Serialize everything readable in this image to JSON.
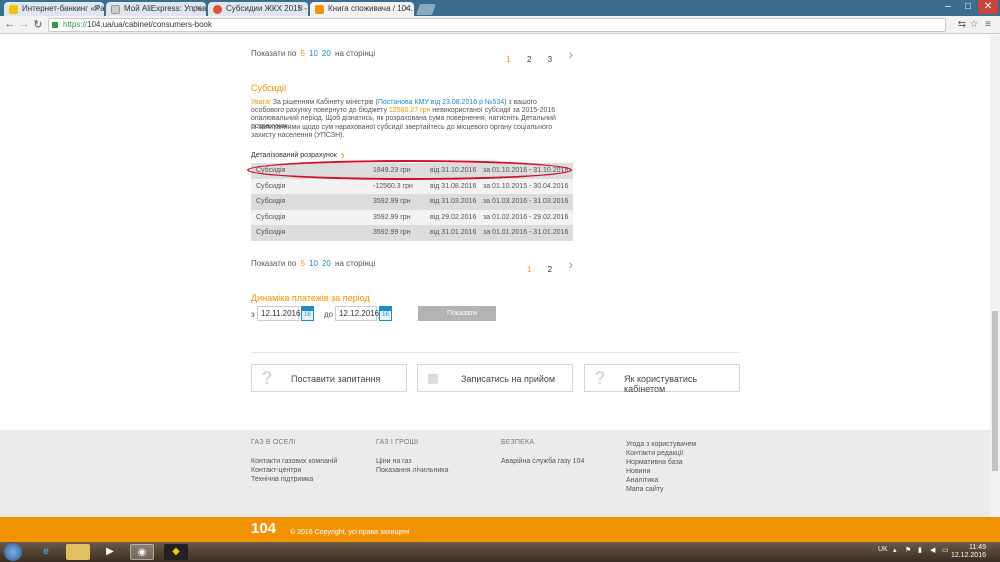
{
  "browser": {
    "tabs": [
      {
        "title": "Интернет-банкинг «Pai",
        "active": false
      },
      {
        "title": "Мой AliExpress: Управл",
        "active": false
      },
      {
        "title": "Субсидии ЖКХ 2015 - С",
        "active": false
      },
      {
        "title": "Книга споживача / 104.",
        "active": true
      }
    ],
    "address": {
      "proto": "https://",
      "rest": "104.ua/ua/cabinet/consumers-book"
    }
  },
  "pager_top": {
    "prefix": "Показати по",
    "n5": "5",
    "n10": "10",
    "n20": "20",
    "suffix": "на сторінці",
    "pages": [
      "1",
      "2",
      "3"
    ],
    "current": "1"
  },
  "subsidy": {
    "title": "Субсидії",
    "notice_warn": "Увага!",
    "notice_a": " За рішенням Кабінету міністрів (",
    "notice_link": "Постанова КМУ від 23.08.2016 р №534",
    "notice_b": ") з вашого особового рахунку повернуто до бюджету ",
    "notice_sum": "12560.27 грн",
    "notice_c": " невикористаної субсидії за 2015-2016 опалювальний період. Щоб дізнатись, як розрахована сума повернення, натисніть Детальний розрахунок.",
    "notice2": "Із запитаннями щодо сум нарахованої субсидії звертайтесь до місцевого органу соціального захисту населення (УПСЗН).",
    "detail_link": "Деталізований розрахунок",
    "rows": [
      {
        "name": "Субсидія",
        "amount": "1849.23 грн",
        "from": "від 31.10.2016",
        "period": "за 01.10.2016 - 31.10.2016"
      },
      {
        "name": "Субсидія",
        "amount": "-12560.3 грн",
        "from": "від 31.08.2016",
        "period": "за 01.10.2015 - 30.04.2016"
      },
      {
        "name": "Субсидія",
        "amount": "3592.99 грн",
        "from": "від 31.03.2016",
        "period": "за 01.03.2016 - 31.03.2016"
      },
      {
        "name": "Субсидія",
        "amount": "3592.99 грн",
        "from": "від 29.02.2016",
        "period": "за 01.02.2016 - 29.02.2016"
      },
      {
        "name": "Субсидія",
        "amount": "3592.99 грн",
        "from": "від 31.01.2016",
        "period": "за 01.01.2016 - 31.01.2016"
      }
    ]
  },
  "pager_bottom": {
    "prefix": "Показати по",
    "n5": "5",
    "n10": "10",
    "n20": "20",
    "suffix": "на сторінці",
    "pages": [
      "1",
      "2"
    ],
    "current": "1"
  },
  "dynamics": {
    "title": "Динаміка платежів за період",
    "from_label": "з",
    "from_value": "12.11.2016",
    "to_label": "до",
    "to_value": "12.12.2016",
    "cal_label": "16",
    "show_button": "Показати"
  },
  "cards": [
    {
      "label": "Поставити запитання",
      "icon": "question-icon"
    },
    {
      "label": "Записатись на прийом",
      "icon": "calendar-icon"
    },
    {
      "label": "Як користуватись кабінетом",
      "icon": "question-icon"
    }
  ],
  "footer": {
    "col1": {
      "title": "ГАЗ В ОСЕЛІ",
      "items": [
        "Контакти газових компаній",
        "Контакт-центри",
        "Технічна підтримка"
      ]
    },
    "col2": {
      "title": "ГАЗ І ГРОШІ",
      "items": [
        "Ціни на газ",
        "Показання лічильника"
      ]
    },
    "col3": {
      "title": "БЕЗПЕКА",
      "items": [
        "Аварійна служба газу 104"
      ]
    },
    "col4": {
      "items": [
        "Угода з користувачем",
        "Контакти редакції",
        "Нормативна база",
        "Новини",
        "Аналітика",
        "Мапа сайту"
      ]
    }
  },
  "bottom_bar": {
    "logo": "104",
    "copyright": "© 2016 Copyright, усі права захищені"
  },
  "taskbar": {
    "lang": "UK",
    "time": "11:49",
    "date": "12.12.2016"
  },
  "colors": {
    "accent": "#f39200",
    "link": "#1e8bc3",
    "highlight_ellipse": "#d0102a"
  }
}
